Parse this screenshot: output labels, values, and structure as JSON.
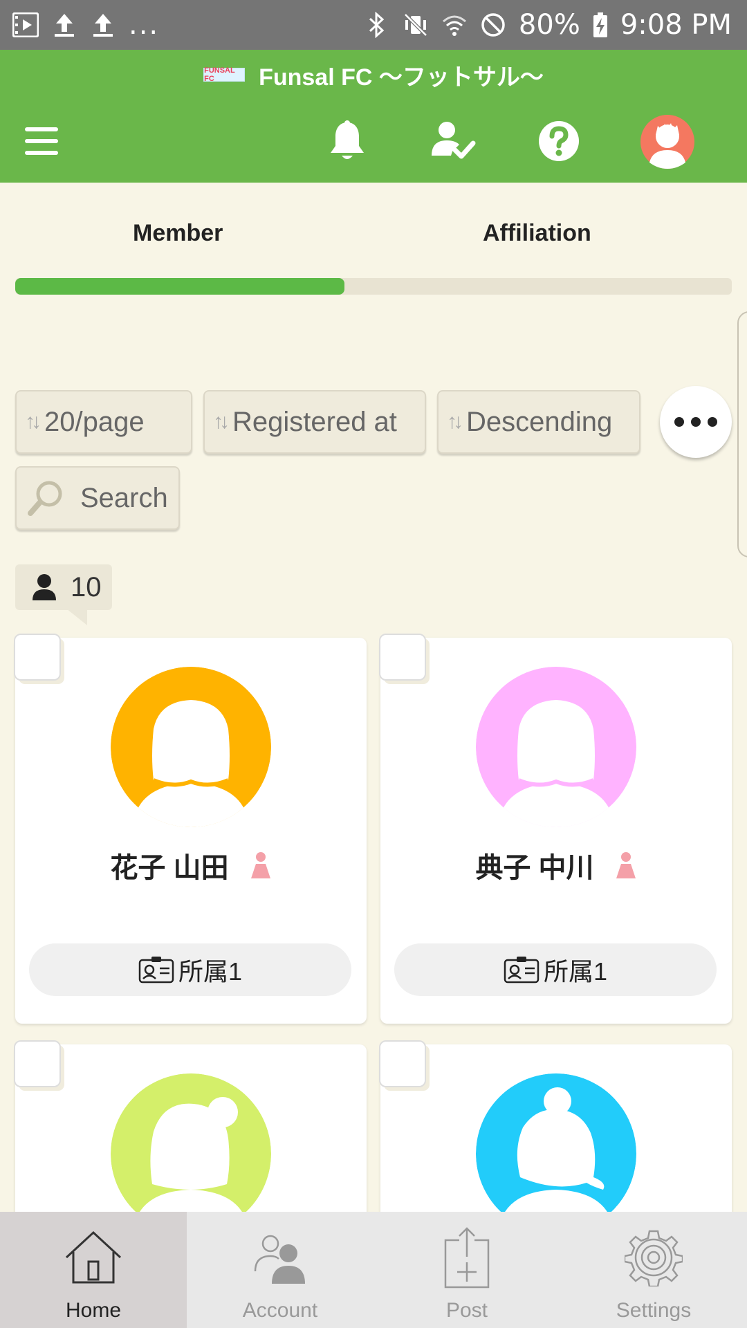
{
  "status_bar": {
    "battery": "80%",
    "time": "9:08 PM",
    "dots": "...",
    "left_icons": [
      "video-icon",
      "upload-icon",
      "upload-icon"
    ],
    "right_icons": [
      "bluetooth-icon",
      "vibrate-icon",
      "wifi-icon",
      "do-not-disturb-icon",
      "battery-charging-icon"
    ]
  },
  "app": {
    "title": "Funsal FC 〜フットサル〜",
    "logo_text": "FUNSAL FC"
  },
  "toolbar": {
    "icons": [
      "menu-icon",
      "bell-icon",
      "user-check-icon",
      "help-icon",
      "profile-avatar"
    ]
  },
  "tabs": [
    {
      "label": "Member",
      "active": true
    },
    {
      "label": "Affiliation",
      "active": false
    }
  ],
  "tab_progress": 0.46,
  "filters": {
    "per_page": "20/page",
    "sort_field": "Registered at",
    "sort_order": "Descending",
    "search_placeholder": "Search"
  },
  "member_count": "10",
  "members": [
    {
      "name": "花子 山田",
      "affiliation": "所属1",
      "avatar_color": "#ffb300",
      "gender_icon": "person-female-icon"
    },
    {
      "name": "典子 中川",
      "affiliation": "所属1",
      "avatar_color": "#ffb3ff",
      "gender_icon": "person-female-icon"
    },
    {
      "name": "",
      "affiliation": "",
      "avatar_color": "#d4ef6a"
    },
    {
      "name": "",
      "affiliation": "",
      "avatar_color": "#22ccfa"
    }
  ],
  "bottom_nav": [
    {
      "label": "Home",
      "icon": "home-icon",
      "active": true
    },
    {
      "label": "Account",
      "icon": "account-icon",
      "active": false
    },
    {
      "label": "Post",
      "icon": "post-icon",
      "active": false
    },
    {
      "label": "Settings",
      "icon": "settings-icon",
      "active": false
    }
  ],
  "colors": {
    "brand_green": "#6ab74a",
    "background": "#f8f5e6",
    "progress_green": "#5cb946",
    "profile_orange": "#f47860",
    "gender_pink": "#f4a0a8"
  }
}
